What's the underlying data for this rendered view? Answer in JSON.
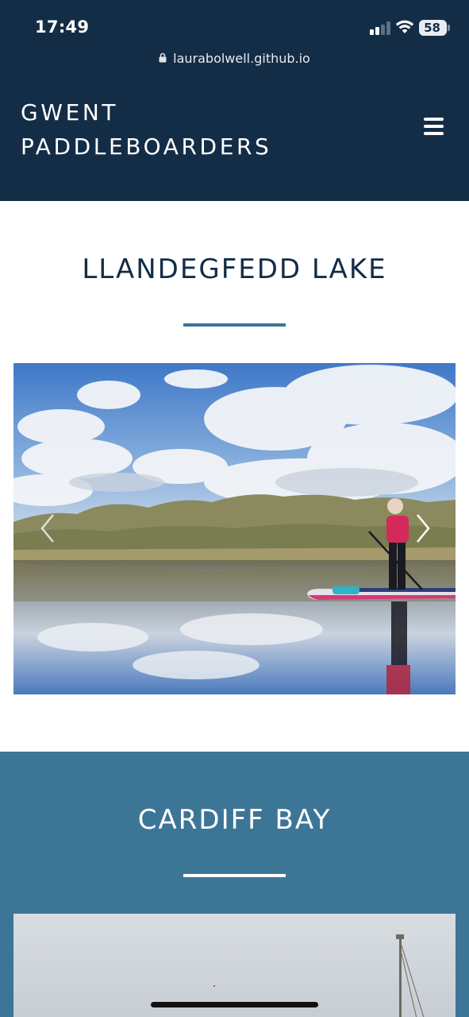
{
  "status_bar": {
    "time": "17:49",
    "battery": "58",
    "icons": [
      "signal-icon",
      "wifi-icon",
      "battery-icon"
    ]
  },
  "browser": {
    "url": "laurabolwell.github.io",
    "icon": "lock-icon"
  },
  "navbar": {
    "brand_line1": "GWENT",
    "brand_line2": "PADDLEBOARDERS",
    "menu_icon": "hamburger-menu-icon",
    "background": "#132d47"
  },
  "sections": [
    {
      "title": "LLANDEGFEDD LAKE",
      "background": "#ffffff",
      "title_color": "#132d47",
      "divider_color": "#3d7597",
      "carousel": {
        "prev_icon": "chevron-left-icon",
        "next_icon": "chevron-right-icon"
      }
    },
    {
      "title": "CARDIFF BAY",
      "background": "#3d7597",
      "title_color": "#ffffff",
      "divider_color": "#ffffff"
    }
  ]
}
